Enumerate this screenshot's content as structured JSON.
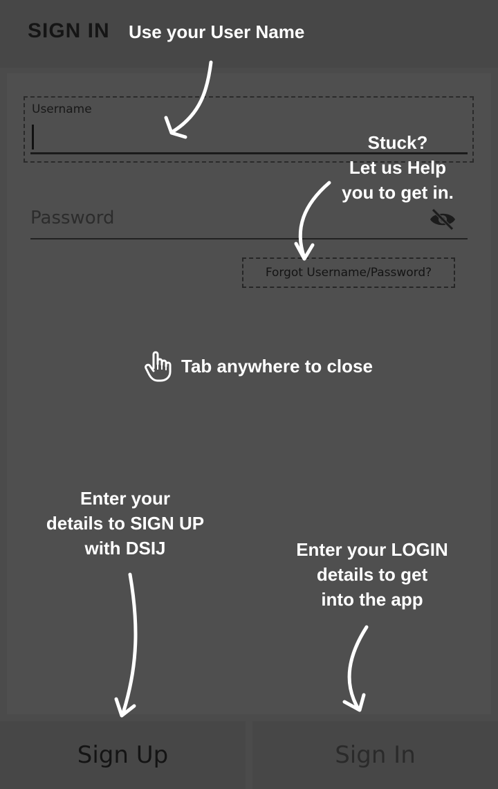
{
  "header": {
    "title": "SIGN IN"
  },
  "form": {
    "username_label": "Username",
    "password_placeholder": "Password",
    "forgot_link": "Forgot Username/Password?"
  },
  "overlay": {
    "username_hint": "Use your User Name",
    "forgot_hint": [
      "Stuck?",
      "Let us Help",
      "you to get in."
    ],
    "close_hint": "Tab anywhere to close",
    "signup_hint": [
      "Enter your",
      "details to SIGN UP",
      "with DSIJ"
    ],
    "login_hint": [
      "Enter your LOGIN",
      "details to get",
      "into the app"
    ]
  },
  "buttons": {
    "sign_up": "Sign Up",
    "sign_in": "Sign In"
  },
  "icons": {
    "password_toggle": "eye-slash-icon",
    "close_hint": "tap-hand-icon"
  },
  "colors": {
    "overlay_bg": "#4b4b4b",
    "hint_text": "#ffffff"
  }
}
